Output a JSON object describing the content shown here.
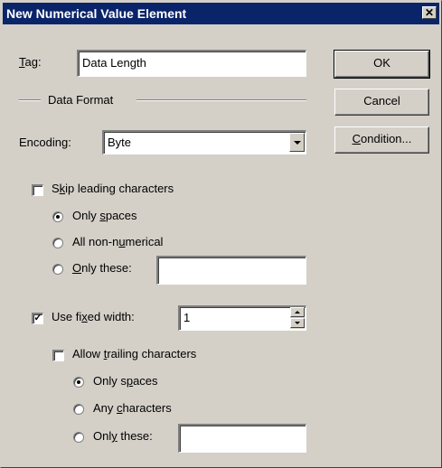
{
  "window": {
    "title": "New Numerical Value Element",
    "close_glyph": "✕"
  },
  "tag": {
    "label_pre": "",
    "label_u": "T",
    "label_post": "ag:",
    "value": "Data Length"
  },
  "buttons": {
    "ok": "OK",
    "cancel": "Cancel",
    "condition_u": "C",
    "condition_post": "ondition..."
  },
  "data_format": {
    "heading": "Data Format"
  },
  "encoding": {
    "label": "Encoding:",
    "value": "Byte"
  },
  "skip_leading": {
    "checked": false,
    "label_pre": "S",
    "label_u": "k",
    "label_post": "ip leading characters",
    "options": [
      {
        "pre": "Only ",
        "u": "s",
        "post": "paces",
        "selected": true
      },
      {
        "pre": "All non-n",
        "u": "u",
        "post": "merical",
        "selected": false
      },
      {
        "pre": "",
        "u": "O",
        "post": "nly these:",
        "selected": false
      }
    ],
    "only_these_value": ""
  },
  "fixed_width": {
    "checked": true,
    "check_glyph": "✓",
    "label_pre": "Use fi",
    "label_u": "x",
    "label_post": "ed width:",
    "value": "1"
  },
  "trailing": {
    "checked": false,
    "label_pre": "Allow ",
    "label_u": "t",
    "label_post": "railing characters",
    "options": [
      {
        "pre": "Only s",
        "u": "p",
        "post": "aces",
        "selected": true
      },
      {
        "pre": "Any ",
        "u": "c",
        "post": "haracters",
        "selected": false
      },
      {
        "pre": "Onl",
        "u": "y",
        "post": " these:",
        "selected": false
      }
    ],
    "only_these_value": ""
  }
}
